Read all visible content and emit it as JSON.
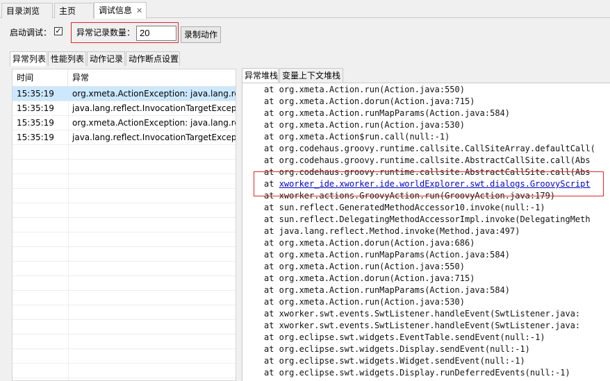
{
  "top_tabs": [
    {
      "label": "目录浏览",
      "active": false
    },
    {
      "label": "主页",
      "active": false
    },
    {
      "label": "调试信息",
      "active": true
    }
  ],
  "toolbar": {
    "debug_label": "启动调试：",
    "debug_checked_mark": "✓",
    "exception_count_label": "异常记录数量：",
    "exception_count_value": "20",
    "record_button": "录制动作"
  },
  "sub_tabs": [
    "异常列表",
    "性能列表",
    "动作记录",
    "动作断点设置"
  ],
  "table": {
    "columns": [
      "时间",
      "异常"
    ],
    "rows": [
      {
        "time": "15:35:19",
        "exception": "org.xmeta.ActionException: java.lang.reflect.",
        "selected": true
      },
      {
        "time": "15:35:19",
        "exception": "java.lang.reflect.InvocationTargetException",
        "selected": false
      },
      {
        "time": "15:35:19",
        "exception": "org.xmeta.ActionException: java.lang.reflect.",
        "selected": false
      },
      {
        "time": "15:35:19",
        "exception": "java.lang.reflect.InvocationTargetException",
        "selected": false
      }
    ]
  },
  "right_tabs": [
    {
      "label": "异常堆栈",
      "active": true
    },
    {
      "label": "变量上下文堆栈",
      "active": false
    }
  ],
  "stacktrace": [
    "at org.xmeta.Action.run(Action.java:550)",
    "at org.xmeta.Action.dorun(Action.java:715)",
    "at org.xmeta.Action.runMapParams(Action.java:584)",
    "at org.xmeta.Action.run(Action.java:530)",
    "at org.xmeta.Action$run.call(null:-1)",
    "at org.codehaus.groovy.runtime.callsite.CallSiteArray.defaultCall(",
    "at org.codehaus.groovy.runtime.callsite.AbstractCallSite.call(Abs",
    "at org.codehaus.groovy.runtime.callsite.AbstractCallSite.call(Abs",
    "xworker_ide.xworker.ide.worldExplorer.swt.dialogs.GroovyScript",
    "at xworker.actions.GroovyAction.run(GroovyAction.java:179)",
    "at sun.reflect.GeneratedMethodAccessor10.invoke(null:-1)",
    "at sun.reflect.DelegatingMethodAccessorImpl.invoke(DelegatingMeth",
    "at java.lang.reflect.Method.invoke(Method.java:497)",
    "at org.xmeta.Action.dorun(Action.java:686)",
    "at org.xmeta.Action.runMapParams(Action.java:584)",
    "at org.xmeta.Action.run(Action.java:550)",
    "at org.xmeta.Action.dorun(Action.java:715)",
    "at org.xmeta.Action.runMapParams(Action.java:584)",
    "at org.xmeta.Action.run(Action.java:530)",
    "at xworker.swt.events.SwtListener.handleEvent(SwtListener.java:",
    "at xworker.swt.events.SwtListener.handleEvent(SwtListener.java:",
    "at org.eclipse.swt.widgets.EventTable.sendEvent(null:-1)",
    "at org.eclipse.swt.widgets.Display.sendEvent(null:-1)",
    "at org.eclipse.swt.widgets.Widget.sendEvent(null:-1)",
    "at org.eclipse.swt.widgets.Display.runDeferredEvents(null:-1)"
  ],
  "link_line_prefix": "at ",
  "colors": {
    "highlight_red": "#e0262a",
    "selected_row": "#cce8ff",
    "link": "#0000cc"
  }
}
